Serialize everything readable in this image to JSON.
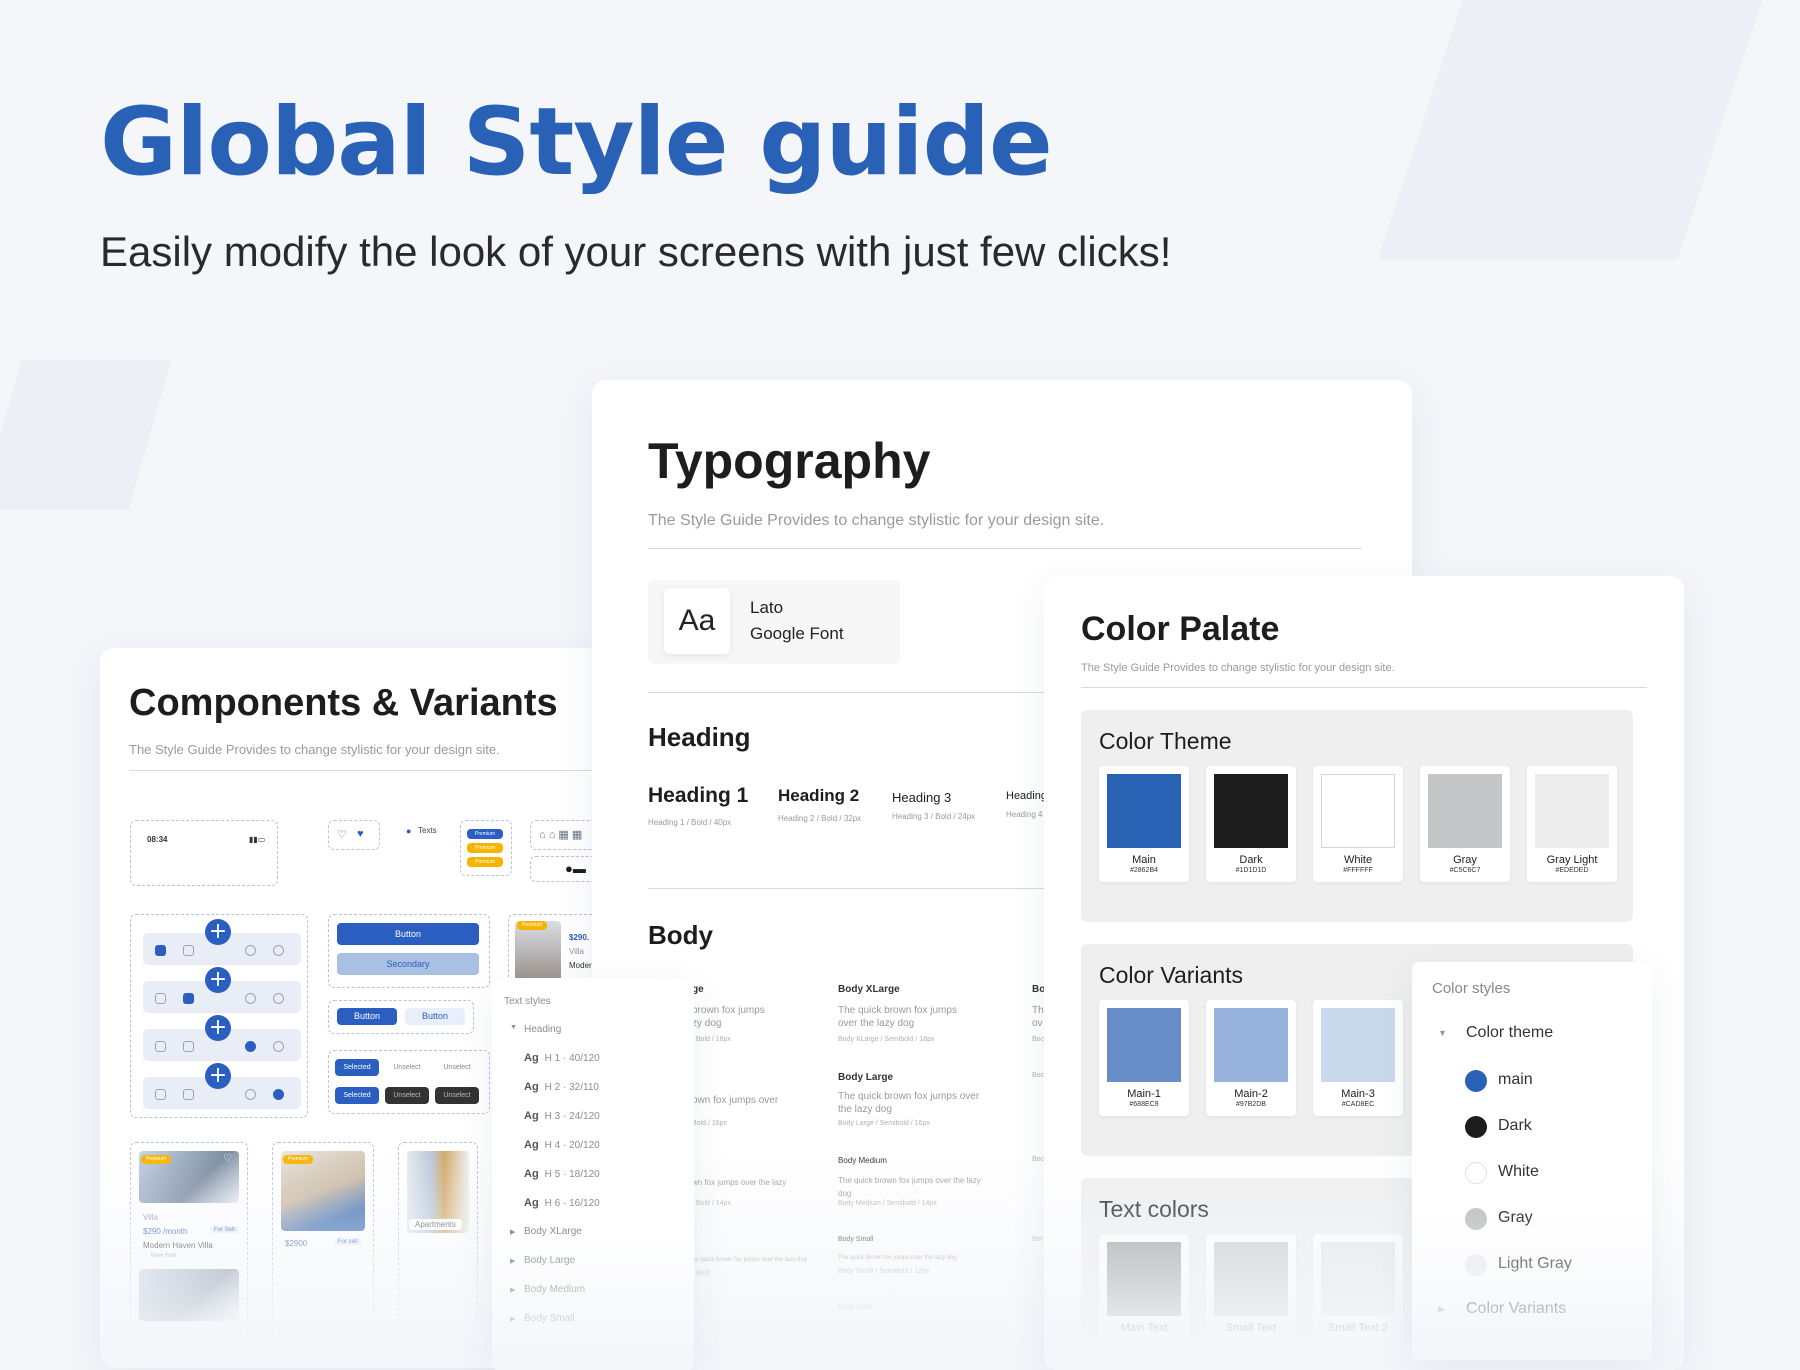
{
  "hero": {
    "title": "Global Style guide",
    "subtitle": "Easily modify the look of your screens with just few clicks!"
  },
  "components": {
    "title": "Components & Variants",
    "description": "The Style Guide Provides to change stylistic for your design site.",
    "status_time": "08:34",
    "texts_label": "Texts",
    "premium_label": "Premium",
    "button_label": "Button",
    "secondary_label": "Secondary",
    "selected_label": "Selected",
    "unselect_label": "Unselect",
    "listing_price": "$290.",
    "listing_villa": "Villa",
    "listing_name": "Moder",
    "card1_type": "Villa",
    "card1_price": "$290 /month",
    "card1_tag": "For Sell",
    "card1_name": "Modern Haven Villa",
    "card1_loc": "New York",
    "card2_price": "$2900",
    "card2_tag": "For sell",
    "card3_label": "Apartments"
  },
  "text_styles": {
    "title": "Text styles",
    "heading_group": "Heading",
    "items": [
      {
        "tag": "H 1",
        "spec": "40/120"
      },
      {
        "tag": "H 2",
        "spec": "32/110"
      },
      {
        "tag": "H 3",
        "spec": "24/120"
      },
      {
        "tag": "H 4",
        "spec": "20/120"
      },
      {
        "tag": "H 5",
        "spec": "18/120"
      },
      {
        "tag": "H 6",
        "spec": "16/120"
      }
    ],
    "ag": "Ag",
    "groups": [
      "Body XLarge",
      "Body Large",
      "Body Medium",
      "Body Small"
    ]
  },
  "typography": {
    "title": "Typography",
    "description": "The Style Guide Provides to change stylistic for your design site.",
    "font_sample": "Aa",
    "font_name": "Lato",
    "font_source": "Google Font",
    "heading_section": "Heading",
    "headings": [
      {
        "name": "Heading 1",
        "spec": "Heading 1 / Bold / 40px"
      },
      {
        "name": "Heading 2",
        "spec": "Heading 2 / Bold / 32px"
      },
      {
        "name": "Heading 3",
        "spec": "Heading 3 / Bold / 24px"
      },
      {
        "name": "Heading",
        "spec": "Heading 4 /"
      }
    ],
    "body_section": "Body",
    "body_cols": [
      {
        "title": "ge",
        "text": "brown fox jumps\nzy dog",
        "meta": "/ Bold / 18px"
      },
      {
        "title": "Body XLarge",
        "text": "The quick brown fox jumps\nover the lazy dog",
        "meta": "Body XLarge / Semibold / 18px"
      },
      {
        "title": "Bo",
        "text": "Th\nov",
        "meta": "Boc"
      }
    ],
    "body_rows": [
      {
        "left": "own fox jumps over",
        "left_meta": "Bold / 16px",
        "title": "Body Large",
        "text": "The quick brown fox jumps over\nthe lazy dog",
        "meta": "Body Large / Semibold / 16px",
        "right": "Boc"
      },
      {
        "left": "wn fox jumps over the lazy",
        "left_meta": "/ Bold / 14px",
        "title": "Body Medium",
        "text": "The quick brown fox jumps over the lazy\ndog",
        "meta": "Body Medium / Semibold / 14px",
        "right": "Boc"
      },
      {
        "left": "he quick brown fox jumps over the lazy dog",
        "left_meta": "/ Bold",
        "title": "Body Small",
        "text": "The quick brown fox jumps over the lazy dog",
        "meta": "Body Small / Semibold / 12px",
        "right": "Bot"
      }
    ],
    "body_last": "Body small"
  },
  "palate": {
    "title": "Color Palate",
    "description": "The Style Guide Provides to change stylistic for your design site.",
    "theme_title": "Color Theme",
    "theme": [
      {
        "name": "Main",
        "hex": "#2862B4",
        "color": "#2862b4"
      },
      {
        "name": "Dark",
        "hex": "#1D1D1D",
        "color": "#1d1d1d"
      },
      {
        "name": "White",
        "hex": "#FFFFFF",
        "color": "#ffffff"
      },
      {
        "name": "Gray",
        "hex": "#C5C6C7",
        "color": "#c5c6c7"
      },
      {
        "name": "Gray Light",
        "hex": "#EDEDED",
        "color": "#ededed"
      }
    ],
    "variants_title": "Color Variants",
    "variants": [
      {
        "name": "Main-1",
        "hex": "#688EC9",
        "color": "#688ec9"
      },
      {
        "name": "Main-2",
        "hex": "#97B2DB",
        "color": "#97b2db"
      },
      {
        "name": "Main-3",
        "hex": "#CAD8EC",
        "color": "#cad8ec"
      }
    ],
    "text_colors_title": "Text colors",
    "text_colors": [
      {
        "name": "Main Text",
        "color": "#9a9a9a"
      },
      {
        "name": "Small Text",
        "color": "#c9c9c9"
      },
      {
        "name": "Small Text 2",
        "color": "#e6e6e6"
      }
    ]
  },
  "color_styles": {
    "title": "Color styles",
    "group": "Color theme",
    "items": [
      {
        "name": "main",
        "color": "#2961b7"
      },
      {
        "name": "Dark",
        "color": "#1d1d1d"
      },
      {
        "name": "White",
        "color": "#ffffff"
      },
      {
        "name": "Gray",
        "color": "#c5c6c7"
      },
      {
        "name": "Light Gray",
        "color": "#ededed"
      }
    ],
    "next_group": "Color Variants"
  }
}
